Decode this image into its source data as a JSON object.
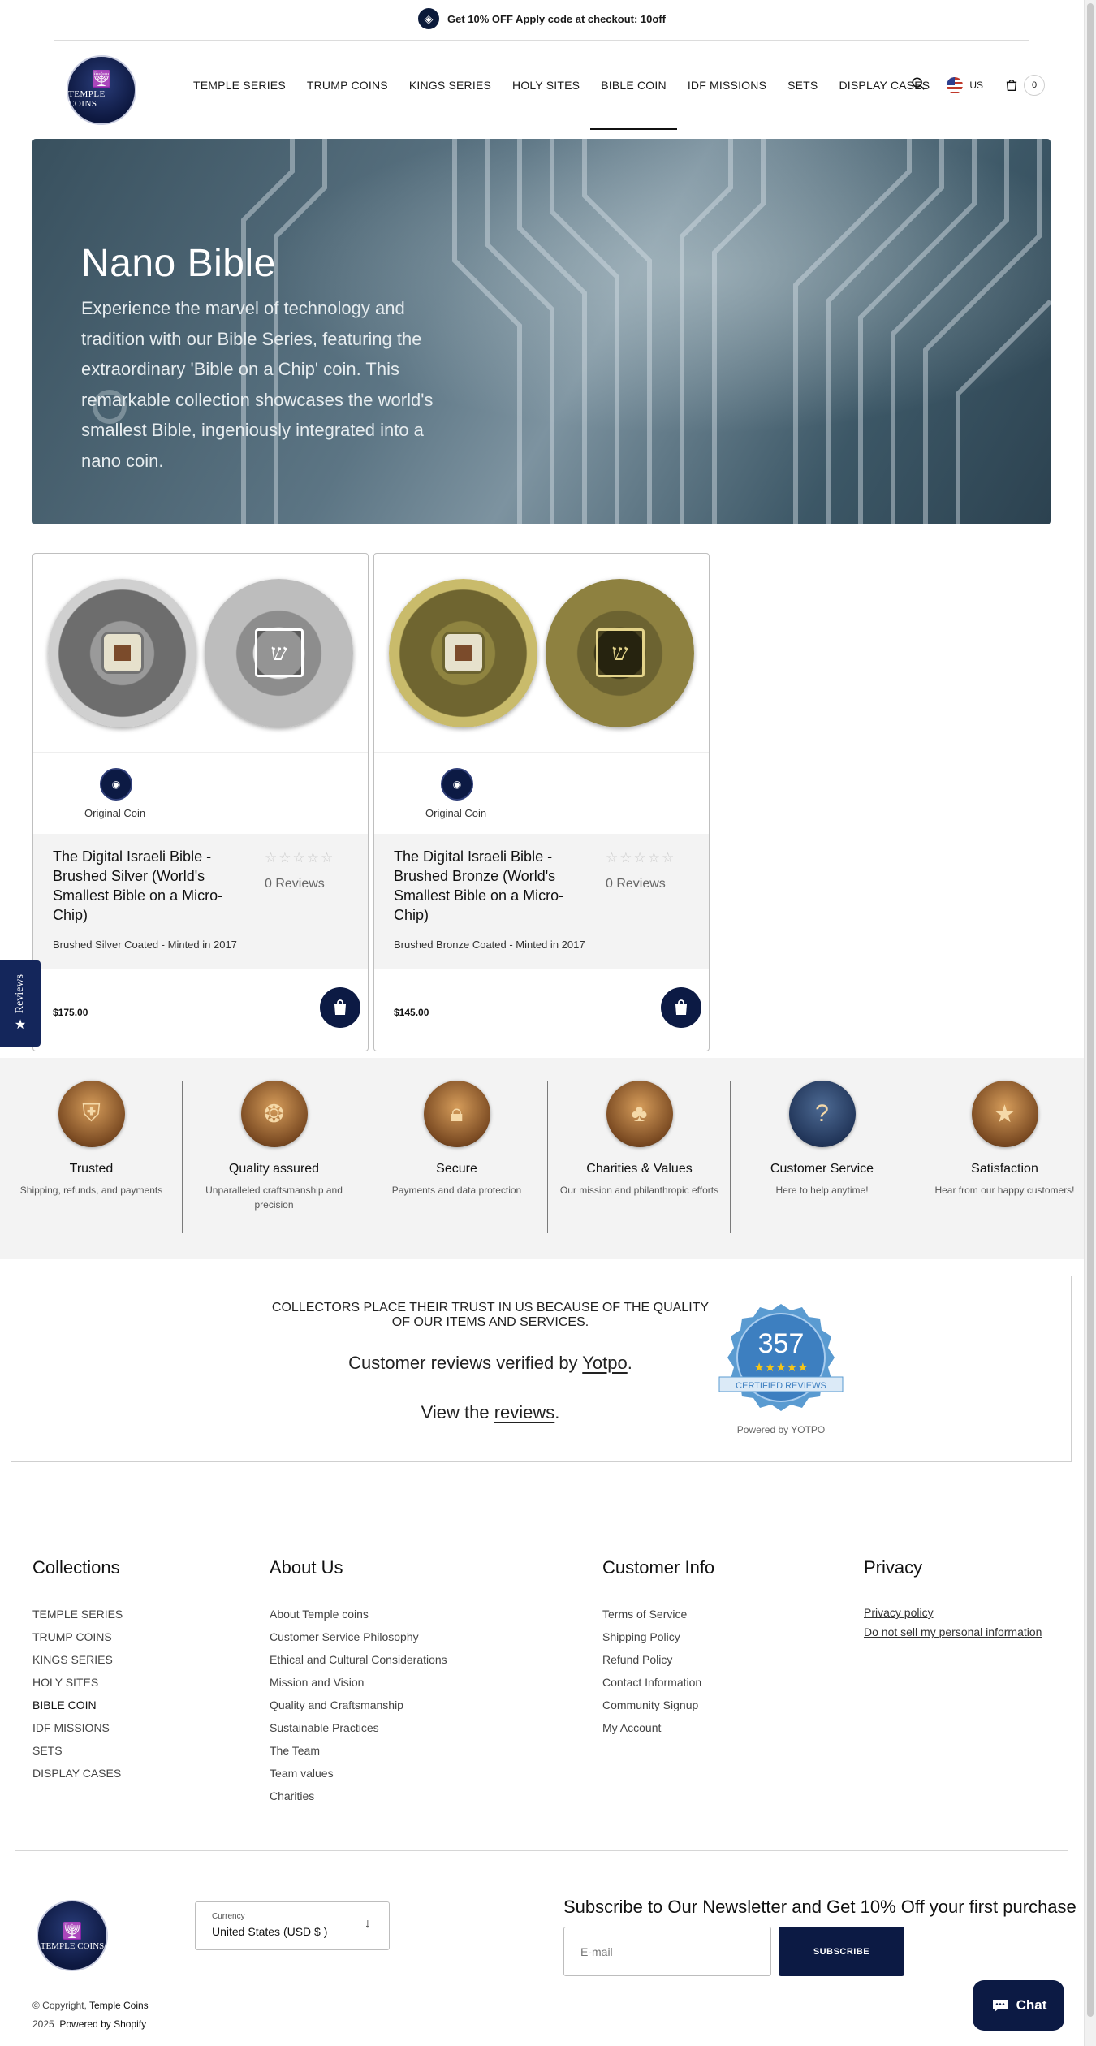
{
  "announcement": {
    "text": "Get 10% OFF Apply code at checkout: 10off",
    "icon": "gift-icon"
  },
  "brand": {
    "logo_text": "TEMPLE COINS"
  },
  "nav": {
    "items": [
      {
        "label": "TEMPLE SERIES"
      },
      {
        "label": "TRUMP COINS"
      },
      {
        "label": "KINGS SERIES"
      },
      {
        "label": "HOLY SITES"
      },
      {
        "label": "BIBLE COIN"
      },
      {
        "label": "IDF MISSIONS"
      },
      {
        "label": "SETS"
      },
      {
        "label": "DISPLAY CASES"
      }
    ],
    "active": "BIBLE COIN",
    "country": "US",
    "cart_count": "0"
  },
  "hero": {
    "title": "Nano Bible",
    "description": "Experience the marvel of technology and tradition with our Bible Series, featuring the extraordinary 'Bible on a Chip' coin. This remarkable collection showcases the world's smallest Bible, ingeniously integrated into a nano coin."
  },
  "products": [
    {
      "badge": "Original Coin",
      "name": "The Digital Israeli Bible - Brushed Silver (World's Smallest Bible on a Micro-Chip)",
      "stars": "☆☆☆☆☆",
      "rating": 0,
      "reviews": "0 Reviews",
      "subtitle": "Brushed Silver Coated - Minted in 2017",
      "price": "$175.00"
    },
    {
      "badge": "Original Coin",
      "name": "The Digital Israeli Bible - Brushed Bronze (World's Smallest Bible on a Micro-Chip)",
      "stars": "☆☆☆☆☆",
      "rating": 0,
      "reviews": "0 Reviews",
      "subtitle": "Brushed Bronze Coated - Minted in 2017",
      "price": "$145.00"
    }
  ],
  "reviews_tab": {
    "label": "Reviews"
  },
  "features": [
    {
      "title": "Trusted",
      "desc": "Shipping, refunds, and payments",
      "icon": "shield-icon"
    },
    {
      "title": "Quality assured",
      "desc": "Unparalleled craftsmanship and precision",
      "icon": "coin-icon"
    },
    {
      "title": "Secure",
      "desc": "Payments and data protection",
      "icon": "lock-icon"
    },
    {
      "title": "Charities & Values",
      "desc": "Our mission and philanthropic efforts",
      "icon": "tree-icon"
    },
    {
      "title": "Customer Service",
      "desc": "Here to help anytime!",
      "icon": "headset-icon"
    },
    {
      "title": "Satisfaction",
      "desc": "Hear from our happy customers!",
      "icon": "star-icon"
    }
  ],
  "yotpo": {
    "trust_text": "COLLECTORS PLACE THEIR TRUST IN US BECAUSE OF THE QUALITY OF OUR ITEMS AND SERVICES.",
    "verified_prefix": "Customer reviews verified by ",
    "verified_link": "Yotpo",
    "view_prefix": "View the ",
    "view_link": "reviews",
    "count": "357",
    "seal_label": "CERTIFIED REVIEWS",
    "powered": "Powered by YOTPO"
  },
  "footer": {
    "collections": {
      "heading": "Collections",
      "links": [
        "TEMPLE SERIES",
        "TRUMP COINS",
        "KINGS SERIES",
        "HOLY SITES",
        "BIBLE COIN",
        "IDF MISSIONS",
        "SETS",
        "DISPLAY CASES"
      ]
    },
    "about": {
      "heading": "About Us",
      "links": [
        "About Temple coins",
        "Customer Service Philosophy",
        "Ethical and Cultural Considerations",
        "Mission and Vision",
        "Quality and Craftsmanship",
        "Sustainable Practices",
        "The Team",
        "Team values",
        "Charities"
      ]
    },
    "customer": {
      "heading": "Customer Info",
      "links": [
        "Terms of Service",
        "Shipping Policy",
        "Refund Policy",
        "Contact Information",
        "Community Signup",
        "My Account"
      ]
    },
    "privacy": {
      "heading": "Privacy",
      "links": [
        "Privacy policy",
        "Do not sell my personal information"
      ]
    },
    "currency_label": "Currency",
    "currency_value": "United States (USD $ )",
    "newsletter_title": "Subscribe to Our Newsletter and Get 10% Off your first purchase",
    "email_placeholder": "E-mail",
    "subscribe": "SUBSCRIBE",
    "copyright_prefix": "© Copyright, ",
    "copyright_brand": "Temple Coins",
    "year": "2025",
    "powered": "Powered by Shopify"
  },
  "chat": {
    "label": "Chat"
  },
  "colors": {
    "navy": "#0c1a44",
    "accent_star": "#f5c518"
  }
}
